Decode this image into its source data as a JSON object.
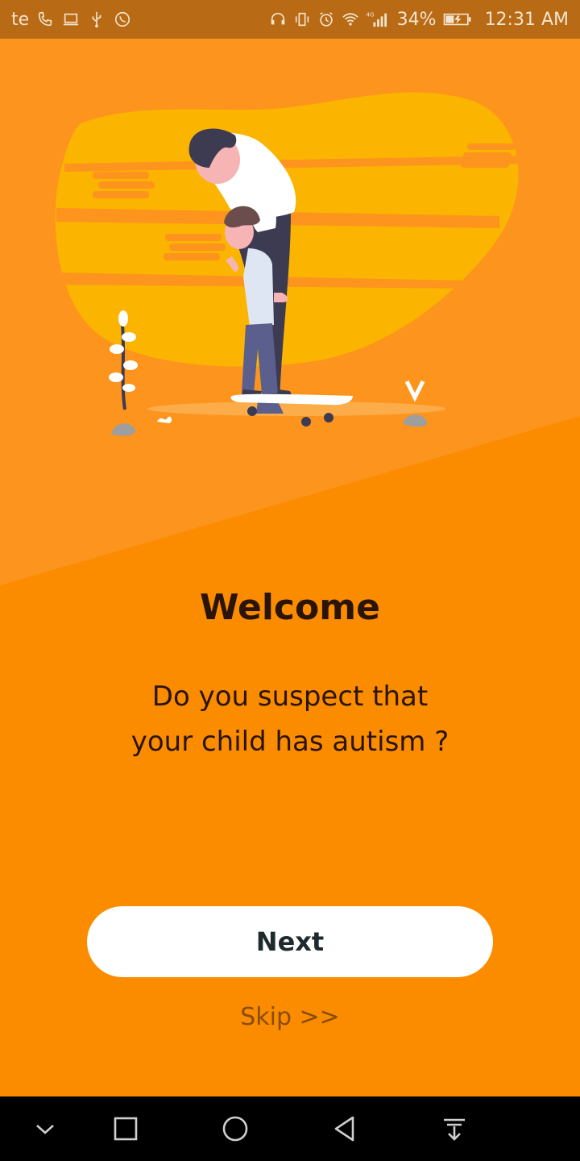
{
  "status_bar": {
    "carrier": "te",
    "network_badge": "4G",
    "battery_percent": "34%",
    "time": "12:31 AM",
    "icons_left": [
      "phone-icon",
      "laptop-icon",
      "usb-icon",
      "whatsapp-icon"
    ],
    "icons_right": [
      "headset-icon",
      "vibrate-icon",
      "alarm-icon",
      "wifi-icon",
      "signal-icon",
      "battery-charging-icon"
    ]
  },
  "welcome": {
    "title": "Welcome",
    "subtitle_line1": "Do you suspect that",
    "subtitle_line2": "your child has autism ?",
    "next_label": "Next",
    "skip_label": "Skip >>"
  },
  "nav_bar": {
    "icons": [
      "chevron-down-icon",
      "recents-square-icon",
      "home-circle-icon",
      "back-triangle-icon",
      "notification-pulldown-icon"
    ]
  },
  "colors": {
    "background": "#fb8c00",
    "background_top": "#fc941e",
    "accent_yellow": "#fbb400",
    "button": "#ffffff",
    "text_dark": "#2a1406",
    "skip_text": "#8a4b0b"
  }
}
